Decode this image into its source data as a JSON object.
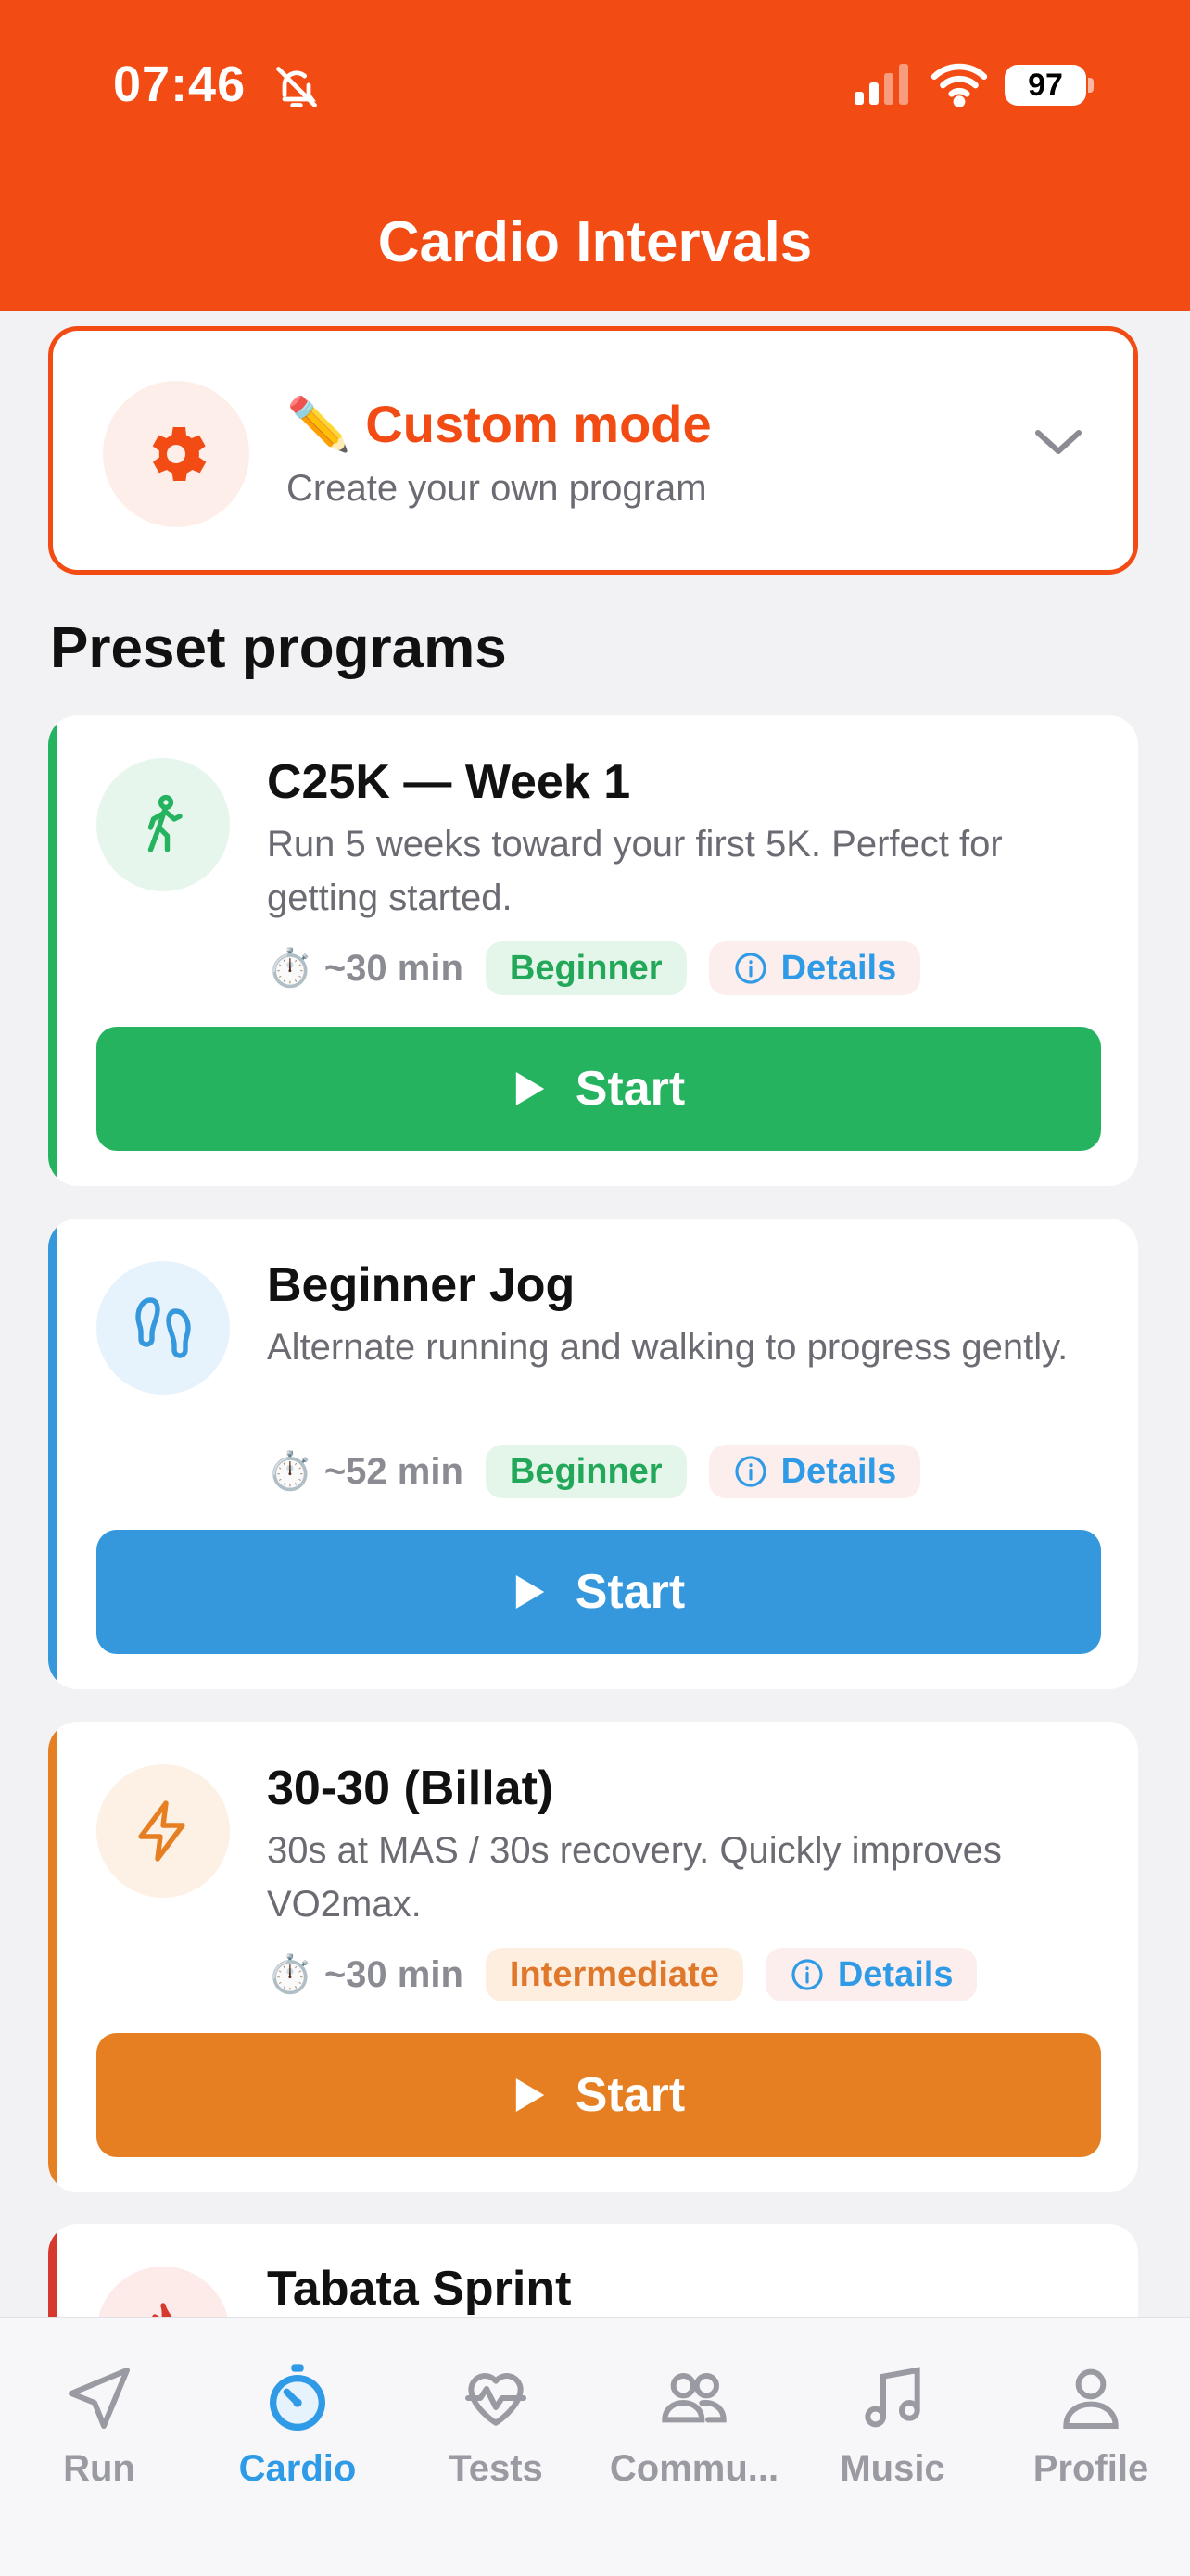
{
  "status": {
    "time": "07:46",
    "battery": "97"
  },
  "header": {
    "title": "Cardio Intervals"
  },
  "custom_mode": {
    "emoji": "✏️",
    "title": "Custom mode",
    "subtitle": "Create your own program"
  },
  "section_title": "Preset programs",
  "programs": [
    {
      "title": "C25K — Week 1",
      "description": "Run 5 weeks toward your first 5K. Perfect for getting started.",
      "clock": "⏱️",
      "duration": "~30 min",
      "level": "Beginner",
      "details_label": "Details",
      "start_label": "Start",
      "color": "#25b35f",
      "icon_bg": "#e6f6ec"
    },
    {
      "title": "Beginner Jog",
      "description": "Alternate running and walking to progress gently.",
      "clock": "⏱️",
      "duration": "~52 min",
      "level": "Beginner",
      "details_label": "Details",
      "start_label": "Start",
      "color": "#3598dc",
      "icon_bg": "#e6f3fc"
    },
    {
      "title": "30-30 (Billat)",
      "description": "30s at MAS / 30s recovery. Quickly improves VO2max.",
      "clock": "⏱️",
      "duration": "~30 min",
      "level": "Intermediate",
      "details_label": "Details",
      "start_label": "Start",
      "color": "#e67e22",
      "icon_bg": "#fdf0e4"
    },
    {
      "title": "Tabata Sprint",
      "color": "#d63a2f",
      "icon_bg": "#fdebea"
    }
  ],
  "tabs": [
    {
      "label": "Run",
      "icon": "navigation-arrow-icon"
    },
    {
      "label": "Cardio",
      "icon": "stopwatch-icon",
      "active": true
    },
    {
      "label": "Tests",
      "icon": "heart-pulse-icon"
    },
    {
      "label": "Commu...",
      "icon": "users-icon"
    },
    {
      "label": "Music",
      "icon": "music-note-icon"
    },
    {
      "label": "Profile",
      "icon": "person-icon"
    }
  ],
  "colors": {
    "accent": "#f24c14",
    "active_tab": "#2f9be6",
    "inactive_tab": "#9a9aa2"
  }
}
